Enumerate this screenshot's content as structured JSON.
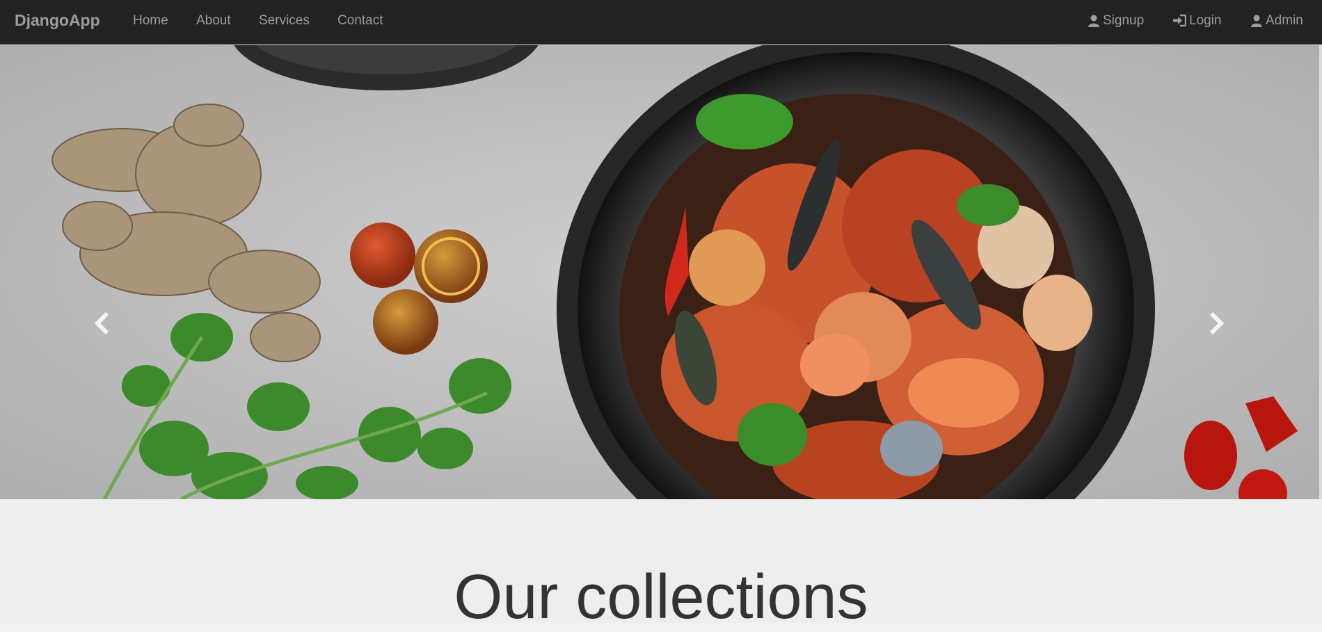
{
  "navbar": {
    "brand": "DjangoApp",
    "links": [
      "Home",
      "About",
      "Services",
      "Contact"
    ],
    "right_links": [
      {
        "label": "Signup",
        "icon": "user-icon"
      },
      {
        "label": "Login",
        "icon": "login-icon"
      },
      {
        "label": "Admin",
        "icon": "user-icon"
      }
    ]
  },
  "carousel": {
    "slide_count": 3,
    "active_index": 0,
    "prev_icon": "chevron-left-icon",
    "next_icon": "chevron-right-icon"
  },
  "section": {
    "title": "Our collections"
  },
  "colors": {
    "navbar_bg": "#222222",
    "nav_text": "#9d9d9d",
    "page_bg": "#eeeeee",
    "title_text": "#333333"
  }
}
